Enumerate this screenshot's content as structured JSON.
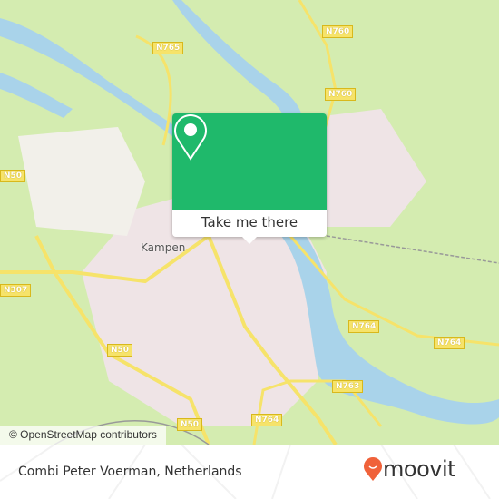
{
  "map": {
    "town_label": "Kampen",
    "road_labels": [
      "N765",
      "N760",
      "N760",
      "N50",
      "N307",
      "N50",
      "N764",
      "N764",
      "N763",
      "N764",
      "N50"
    ],
    "attribution": "© OpenStreetMap contributors",
    "colors": {
      "land": "#d4ecb0",
      "water": "#a9d3ea",
      "urban": "#efe4e6",
      "road": "#f6e36a"
    }
  },
  "popup": {
    "button_label": "Take me there",
    "icon": "map-pin-icon",
    "color": "#1fb96b"
  },
  "footer": {
    "place_name": "Combi Peter Voerman, Netherlands",
    "logo_text": "moovit",
    "logo_color": "#f0623a"
  }
}
